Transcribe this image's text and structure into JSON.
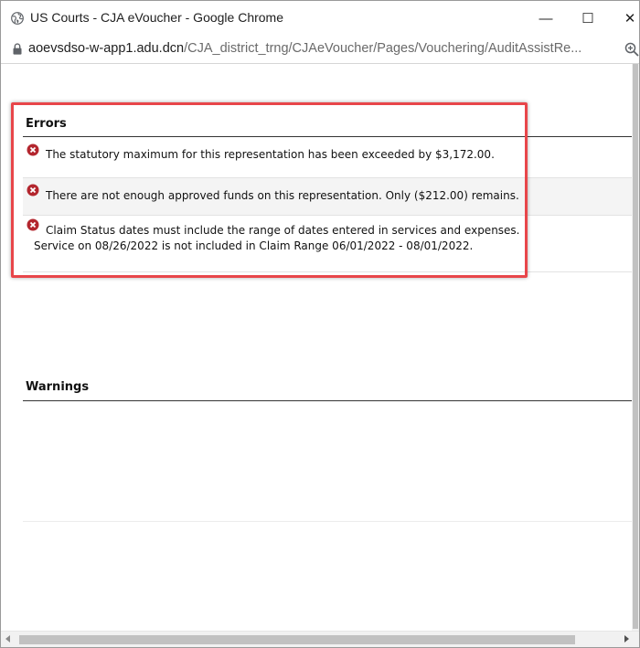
{
  "window": {
    "title": "US Courts - CJA eVoucher - Google Chrome",
    "minimize_glyph": "—",
    "maximize_glyph": "☐",
    "close_glyph": "✕"
  },
  "address_bar": {
    "host": "aoevsdso-w-app1.adu.dcn",
    "path": "/CJA_district_trng/CJAeVoucher/Pages/Vouchering/AuditAssistRe..."
  },
  "errors": {
    "heading": "Errors",
    "items": [
      {
        "line1": "The statutory maximum for this representation has been exceeded by $3,172.00.",
        "line2": ""
      },
      {
        "line1": "There are not enough approved funds on this representation. Only ($212.00) remains.",
        "line2": ""
      },
      {
        "line1": "Claim Status dates must include the range of dates entered in services and expenses.",
        "line2": "Service on 08/26/2022 is not included in Claim Range 06/01/2022 - 08/01/2022."
      }
    ]
  },
  "warnings": {
    "heading": "Warnings"
  },
  "colors": {
    "highlight": "#e8464a",
    "error_icon": "#b3262e"
  },
  "icons": {
    "favicon": "globe-icon",
    "lock": "lock-icon",
    "zoom": "zoom-icon",
    "error": "error-x-icon"
  }
}
